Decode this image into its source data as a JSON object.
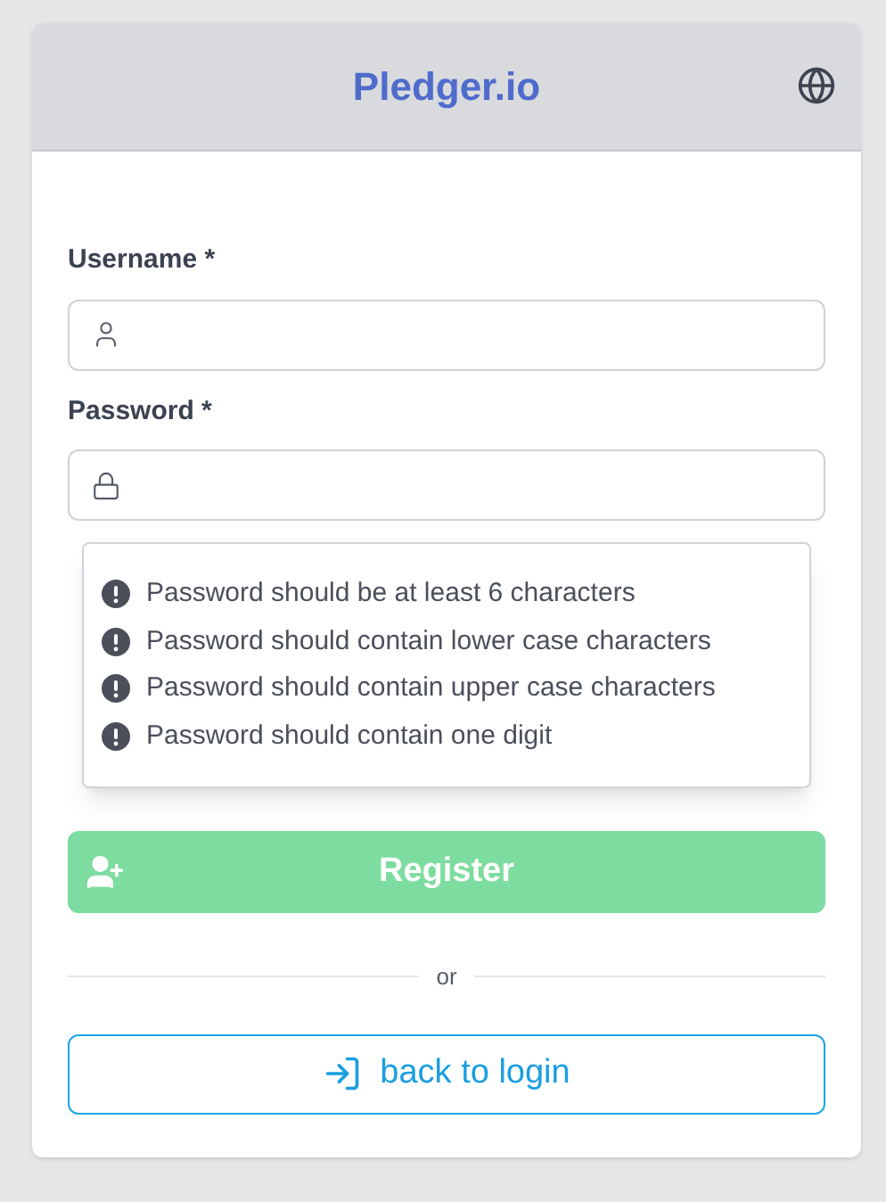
{
  "header": {
    "title": "Pledger.io"
  },
  "fields": [
    {
      "label": "Username *",
      "kind": "user"
    },
    {
      "label": "Password *",
      "kind": "lock"
    }
  ],
  "requirements": [
    "Password should be at least 6 characters",
    "Password should contain lower case characters",
    "Password should contain upper case characters",
    "Password should contain one digit"
  ],
  "register_button": {
    "label": "Register",
    "disabled": true
  },
  "divider": "or",
  "login_button": {
    "label": "back to login"
  }
}
